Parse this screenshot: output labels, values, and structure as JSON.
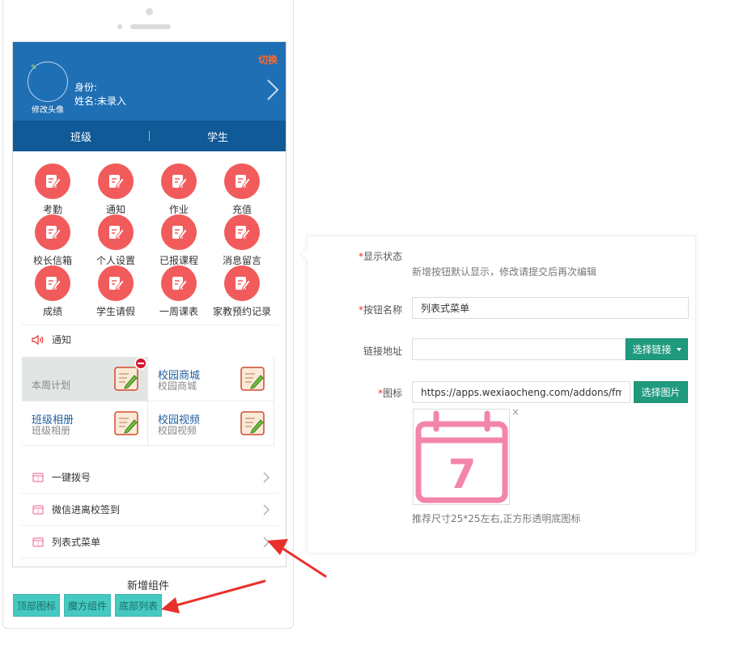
{
  "header": {
    "switch_label": "切换",
    "avatar_caption": "修改头像",
    "identity_label": "身份:",
    "name_label": "姓名:未录入"
  },
  "tabs": [
    {
      "label": "班级"
    },
    {
      "label": "学生"
    }
  ],
  "grid": [
    [
      {
        "label": "考勤"
      },
      {
        "label": "通知"
      },
      {
        "label": "作业"
      },
      {
        "label": "充值"
      }
    ],
    [
      {
        "label": "校长信箱"
      },
      {
        "label": "个人设置"
      },
      {
        "label": "已报课程"
      },
      {
        "label": "消息留言"
      }
    ],
    [
      {
        "label": "成绩"
      },
      {
        "label": "学生请假"
      },
      {
        "label": "一周课表"
      },
      {
        "label": "家教预约记录"
      }
    ]
  ],
  "notice": {
    "label": "通知"
  },
  "cube": [
    {
      "title": "本周计划",
      "subtitle": ""
    },
    {
      "title": "校园商城",
      "subtitle": "校园商城"
    },
    {
      "title": "班级相册",
      "subtitle": "班级相册"
    },
    {
      "title": "校园视频",
      "subtitle": "校园视频"
    }
  ],
  "list_menu": [
    {
      "label": "一键拨号"
    },
    {
      "label": "微信进离校签到"
    },
    {
      "label": "列表式菜单"
    }
  ],
  "new_component": {
    "title": "新增组件",
    "buttons": [
      {
        "label": "顶部图标"
      },
      {
        "label": "魔方组件"
      },
      {
        "label": "底部列表"
      }
    ]
  },
  "panel": {
    "display_status": {
      "label": "显示状态",
      "hint": "新增按钮默认显示，修改请提交后再次编辑"
    },
    "button_name": {
      "label": "按钮名称",
      "value": "列表式菜单"
    },
    "link": {
      "label": "链接地址",
      "value": "",
      "button": "选择链接"
    },
    "icon": {
      "label": "图标",
      "value": "https://apps.wexiaocheng.com/addons/fm_jiaoy",
      "button": "选择图片",
      "preview_day": "7",
      "close": "×",
      "hint": "推荐尺寸25*25左右,正方形透明底图标"
    }
  },
  "colors": {
    "header_blue": "#1f6fb5",
    "tab_bar": "#0f5a97",
    "icon_red": "#f25b5b",
    "accent_green": "#1f9a7e",
    "component_teal": "#45c9c0",
    "arrow_red": "#e8312c",
    "switch_orange": "#ff6a2e"
  }
}
